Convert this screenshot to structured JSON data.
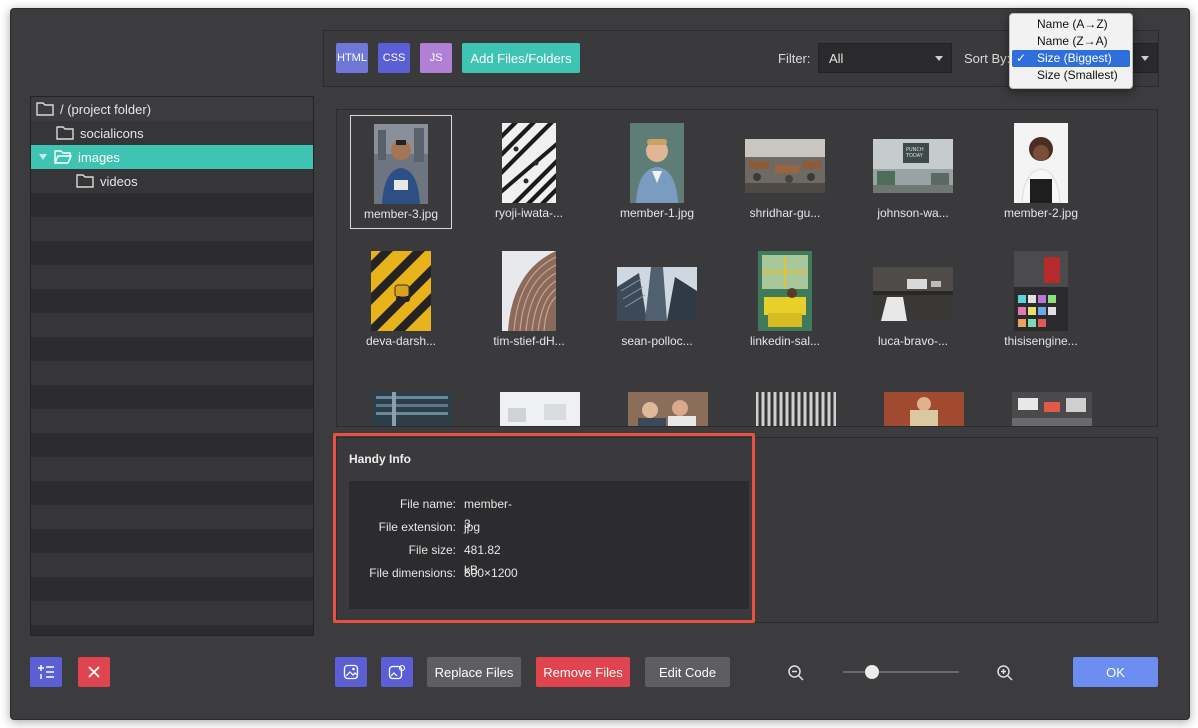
{
  "toolbar": {
    "type_buttons": [
      {
        "label": "HTML",
        "color": "#6d78d9"
      },
      {
        "label": "CSS",
        "color": "#5b5fd6"
      },
      {
        "label": "JS",
        "color": "#b07fd6"
      }
    ],
    "add_label": "Add Files/Folders",
    "filter_label": "Filter:",
    "filter_value": "All",
    "sort_label": "Sort By:"
  },
  "sort_menu": {
    "items": [
      {
        "label": "Name (A→Z)",
        "selected": false
      },
      {
        "label": "Name (Z→A)",
        "selected": false
      },
      {
        "label": "Size (Biggest)",
        "selected": true
      },
      {
        "label": "Size (Smallest)",
        "selected": false
      }
    ],
    "check": "✓"
  },
  "tree": {
    "items": [
      {
        "label": "/ (project folder)"
      },
      {
        "label": "socialicons"
      },
      {
        "label": "images"
      },
      {
        "label": "videos"
      }
    ]
  },
  "grid": {
    "items": [
      {
        "name": "member-3.jpg"
      },
      {
        "name": "ryoji-iwata-..."
      },
      {
        "name": "member-1.jpg"
      },
      {
        "name": "shridhar-gu..."
      },
      {
        "name": "johnson-wa..."
      },
      {
        "name": "member-2.jpg"
      },
      {
        "name": "deva-darsh..."
      },
      {
        "name": "tim-stief-dH..."
      },
      {
        "name": "sean-polloc..."
      },
      {
        "name": "linkedin-sal..."
      },
      {
        "name": "luca-bravo-..."
      },
      {
        "name": "thisisengine..."
      }
    ]
  },
  "info": {
    "title": "Handy Info",
    "rows": [
      {
        "key": "File name:",
        "value": "member-3"
      },
      {
        "key": "File extension:",
        "value": "jpg"
      },
      {
        "key": "File size:",
        "value": "481.82 kB"
      },
      {
        "key": "File dimensions:",
        "value": "800×1200"
      }
    ]
  },
  "footer": {
    "replace_label": "Replace Files",
    "remove_label": "Remove Files",
    "edit_label": "Edit Code",
    "ok_label": "OK",
    "zoom_level": 0.25
  },
  "colors": {
    "accent_teal": "#3fc4b3",
    "danger": "#e0454f",
    "primary": "#6c8ef0",
    "highlight_border": "#e8503f"
  }
}
